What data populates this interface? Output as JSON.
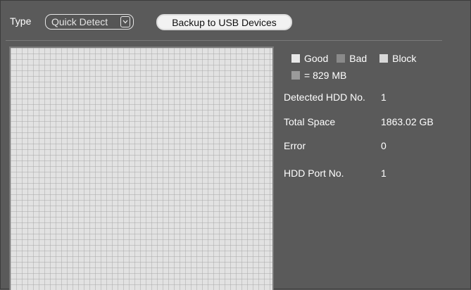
{
  "type_label": "Type",
  "type_select": {
    "value": "Quick Detect"
  },
  "backup_button": {
    "label": "Backup to USB Devices"
  },
  "legend": {
    "good_label": "Good",
    "bad_label": "Bad",
    "block_label": "Block",
    "block_size_text": "= 829 MB",
    "colors": {
      "good": "#e8e8e8",
      "bad": "#8a8a8a",
      "block": "#d8d8d8",
      "unit": "#9a9a9a"
    }
  },
  "info": {
    "detected_hdd_label": "Detected HDD No.",
    "detected_hdd_value": "1",
    "total_space_label": "Total Space",
    "total_space_value": "1863.02 GB",
    "error_label": "Error",
    "error_value": "0",
    "hdd_port_label": "HDD Port No.",
    "hdd_port_value": "1"
  },
  "icons": {
    "dropdown": "chevron-down-icon"
  }
}
